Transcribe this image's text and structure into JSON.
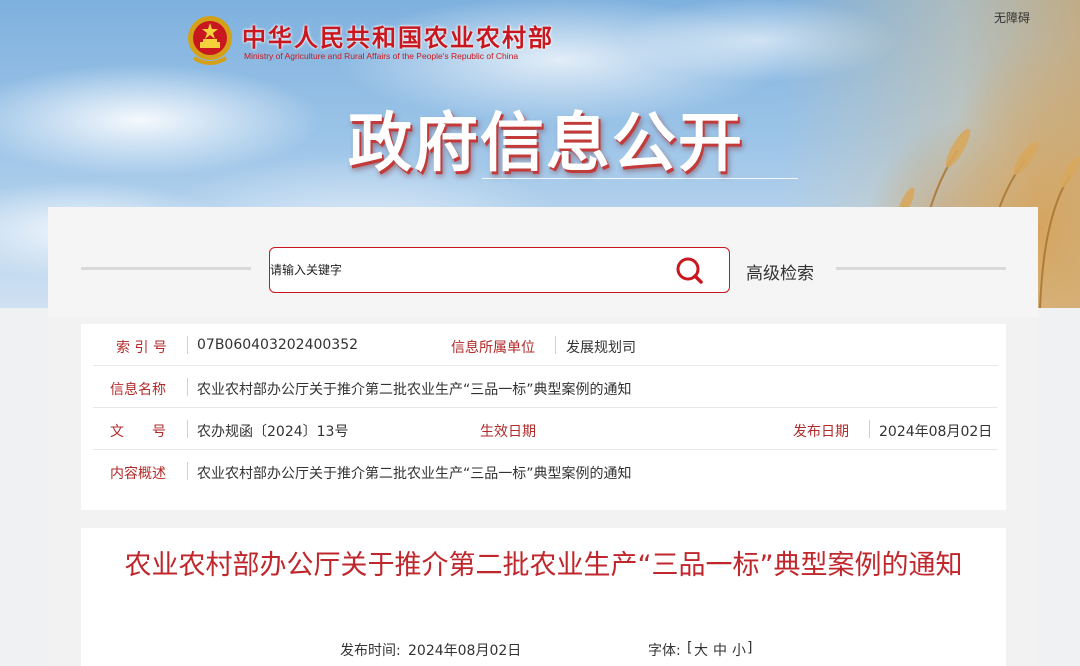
{
  "header": {
    "ministry_cn": "中华人民共和国农业农村部",
    "ministry_en": "Ministry of Agriculture and Rural Affairs of the People's Republic of China",
    "accessibility": "无障碍",
    "banner_title": "政府信息公开"
  },
  "search": {
    "placeholder": "请输入关键字",
    "advanced": "高级检索",
    "icon": "search-icon"
  },
  "info": {
    "index_label": "索 引 号",
    "index_value": "07B060403202400352",
    "unit_label": "信息所属单位",
    "unit_value": "发展规划司",
    "name_label": "信息名称",
    "name_value": "农业农村部办公厅关于推介第二批农业生产“三品一标”典型案例的通知",
    "doc_label": "文　　号",
    "doc_value": "农办规函〔2024〕13号",
    "effective_label": "生效日期",
    "effective_value": "",
    "publish_label": "发布日期",
    "publish_value": "2024年08月02日",
    "summary_label": "内容概述",
    "summary_value": "农业农村部办公厅关于推介第二批农业生产“三品一标”典型案例的通知"
  },
  "article": {
    "title": "农业农村部办公厅关于推介第二批农业生产“三品一标”典型案例的通知",
    "publish_time_label": "发布时间:",
    "publish_time_value": "2024年08月02日",
    "font_label": "字体:",
    "font_open": "[",
    "font_large": "大",
    "font_medium": "中",
    "font_small": "小",
    "font_close": "]"
  },
  "colors": {
    "brand_red": "#c8171e",
    "label_red": "#b22a2a",
    "title_red": "#c0272d"
  }
}
